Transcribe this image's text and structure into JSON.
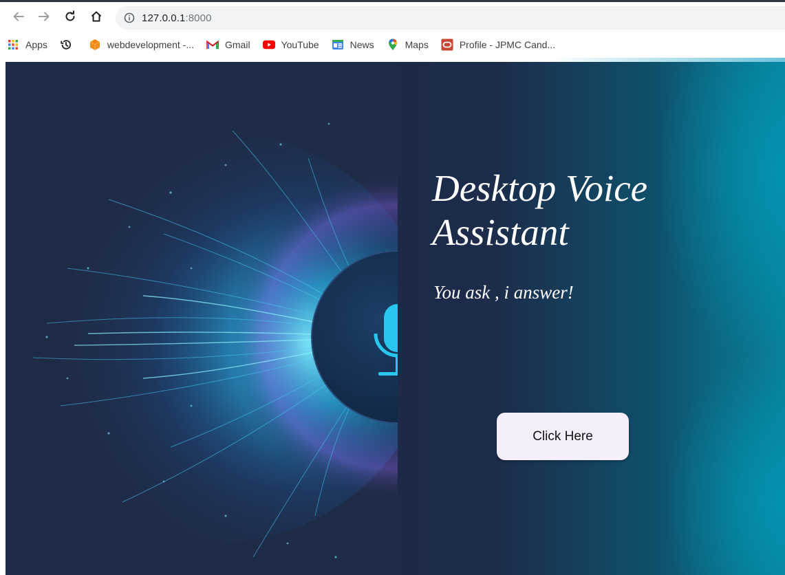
{
  "browser": {
    "url_host": "127.0.0.1",
    "url_port": ":8000",
    "bookmarks": [
      {
        "label": "Apps",
        "icon": "apps-grid-icon"
      },
      {
        "label": "",
        "icon": "history-icon"
      },
      {
        "label": "webdevelopment -...",
        "icon": "orange-cube-icon"
      },
      {
        "label": "Gmail",
        "icon": "gmail-icon"
      },
      {
        "label": "YouTube",
        "icon": "youtube-icon"
      },
      {
        "label": "News",
        "icon": "google-news-icon"
      },
      {
        "label": "Maps",
        "icon": "maps-pin-icon"
      },
      {
        "label": "Profile - JPMC Cand...",
        "icon": "oracle-icon"
      }
    ]
  },
  "hero": {
    "title": "Desktop Voice Assistant",
    "tagline": "You ask , i answer!",
    "button_label": "Click Here"
  },
  "colors": {
    "page_bg": "#1d2b47",
    "accent_teal": "#0a7f99",
    "glow_cyan": "#3fd4ff",
    "button_bg": "#f6eefa"
  }
}
